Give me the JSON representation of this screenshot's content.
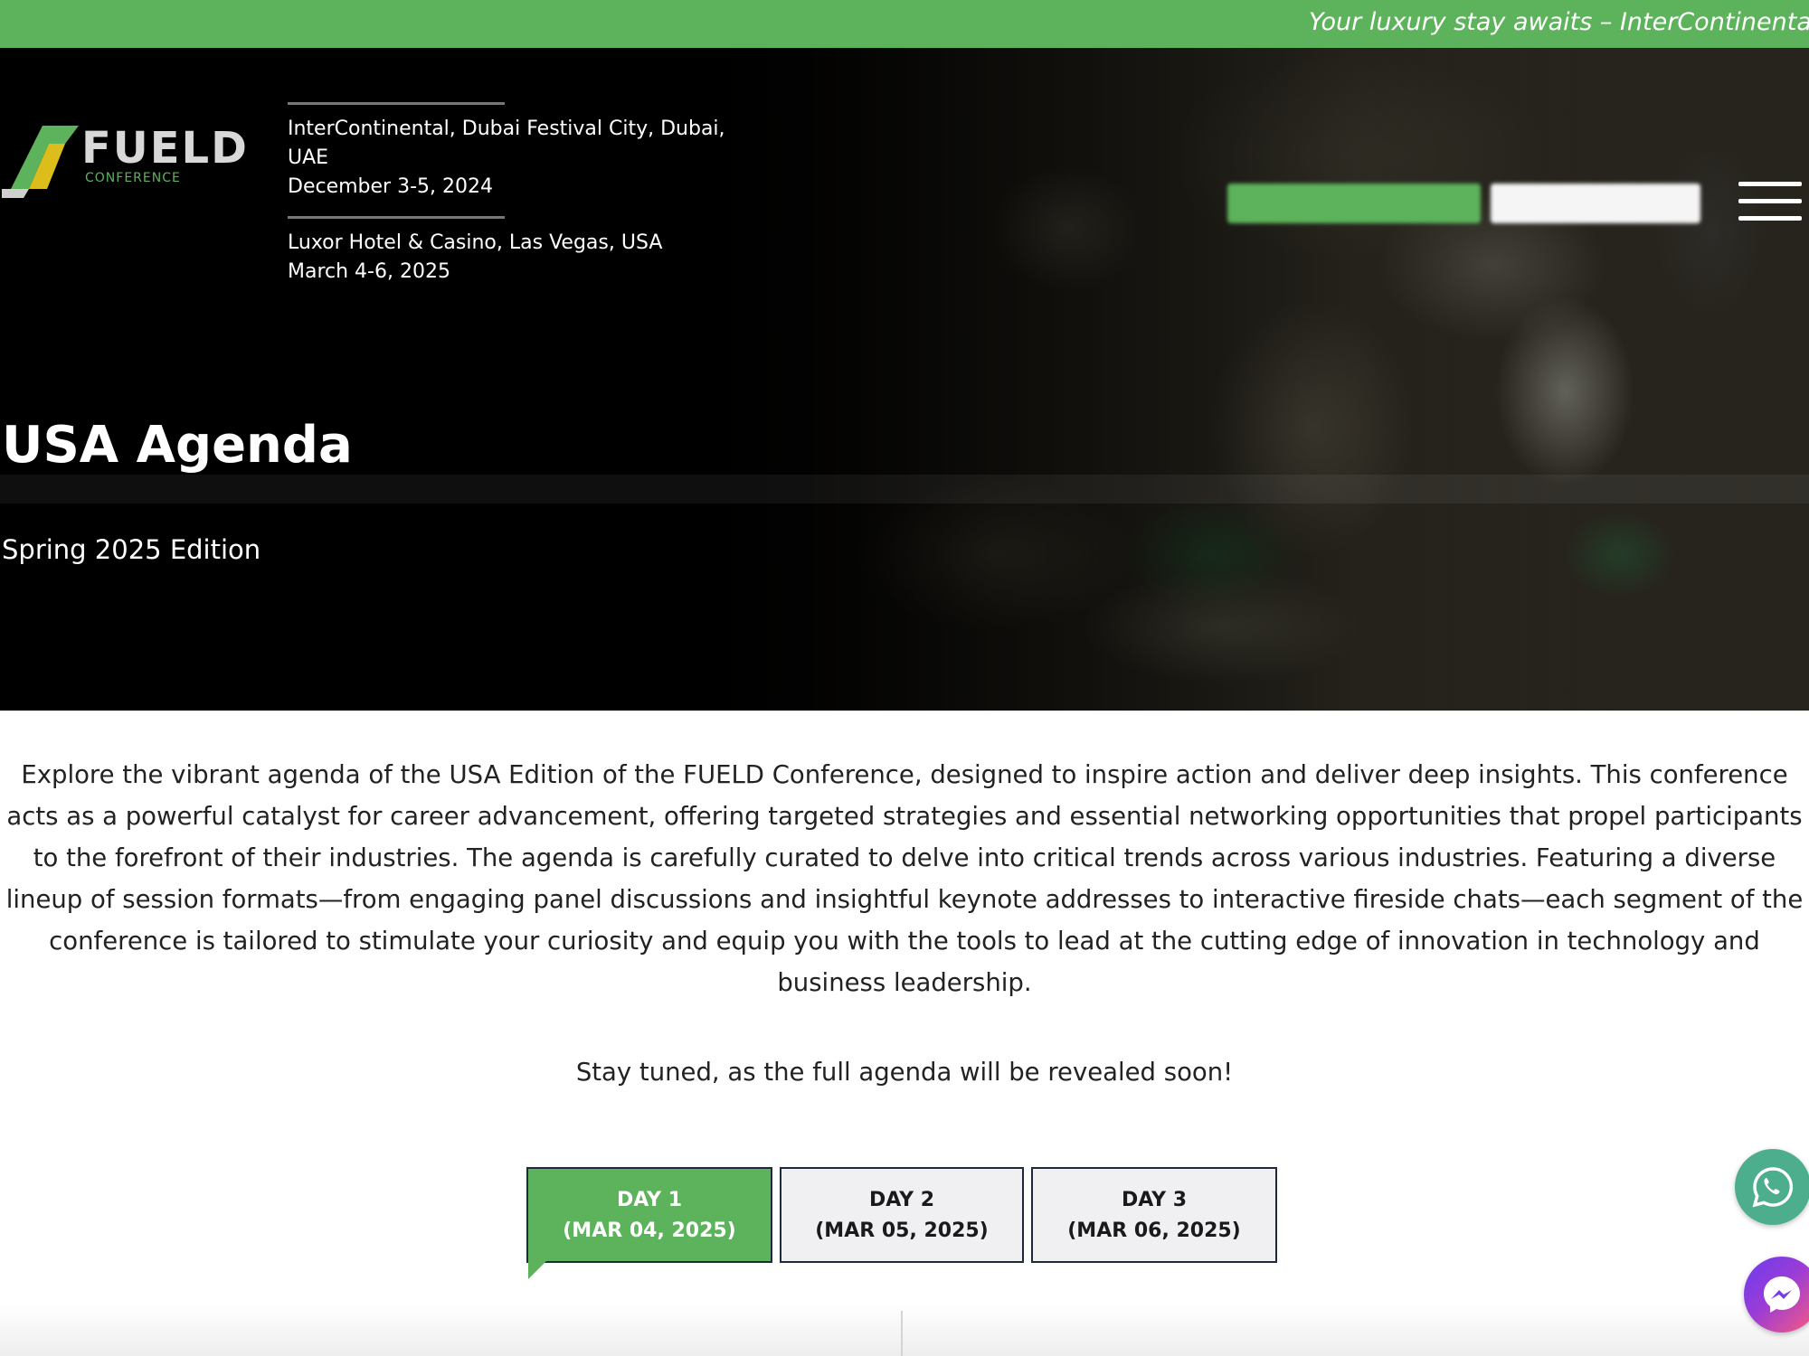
{
  "ticker": {
    "text": "Your luxury stay awaits – InterContinenta"
  },
  "header": {
    "logo": {
      "word": "FUELD",
      "sub": "CONFERENCE"
    },
    "events": [
      {
        "venue": "InterContinental, Dubai Festival City, Dubai, UAE",
        "dates": "December 3-5, 2024"
      },
      {
        "venue": "Luxor Hotel & Casino, Las Vegas, USA",
        "dates": "March 4-6, 2025"
      }
    ],
    "menu_icon": "hamburger-icon"
  },
  "hero": {
    "title": "USA Agenda",
    "subtitle": "Spring 2025 Edition"
  },
  "intro": {
    "paragraph": "Explore the vibrant agenda of the USA Edition of the FUELD Conference, designed to inspire action and deliver deep insights. This conference acts as a powerful catalyst for career advancement, offering targeted strategies and essential networking opportunities that propel participants to the forefront of their industries. The agenda is carefully curated to delve into critical trends across various industries. Featuring a diverse lineup of session formats—from engaging panel discussions and insightful keynote addresses to interactive fireside chats—each segment of the conference is tailored to stimulate your curiosity and equip you with the tools to lead at the cutting edge of innovation in technology and business leadership.",
    "stay_tuned": "Stay tuned, as the full agenda will be revealed soon!"
  },
  "tabs": [
    {
      "day": "DAY 1",
      "date": "(MAR 04, 2025)",
      "active": true
    },
    {
      "day": "DAY 2",
      "date": "(MAR 05, 2025)",
      "active": false
    },
    {
      "day": "DAY 3",
      "date": "(MAR 06, 2025)",
      "active": false
    }
  ],
  "floating": {
    "whatsapp_icon": "whatsapp-icon",
    "messenger_icon": "messenger-icon"
  },
  "colors": {
    "brand_green": "#5db35b",
    "tab_border": "#1e2a3a",
    "tab_inactive_bg": "#f0f0f3",
    "whatsapp": "#4cae8c"
  }
}
